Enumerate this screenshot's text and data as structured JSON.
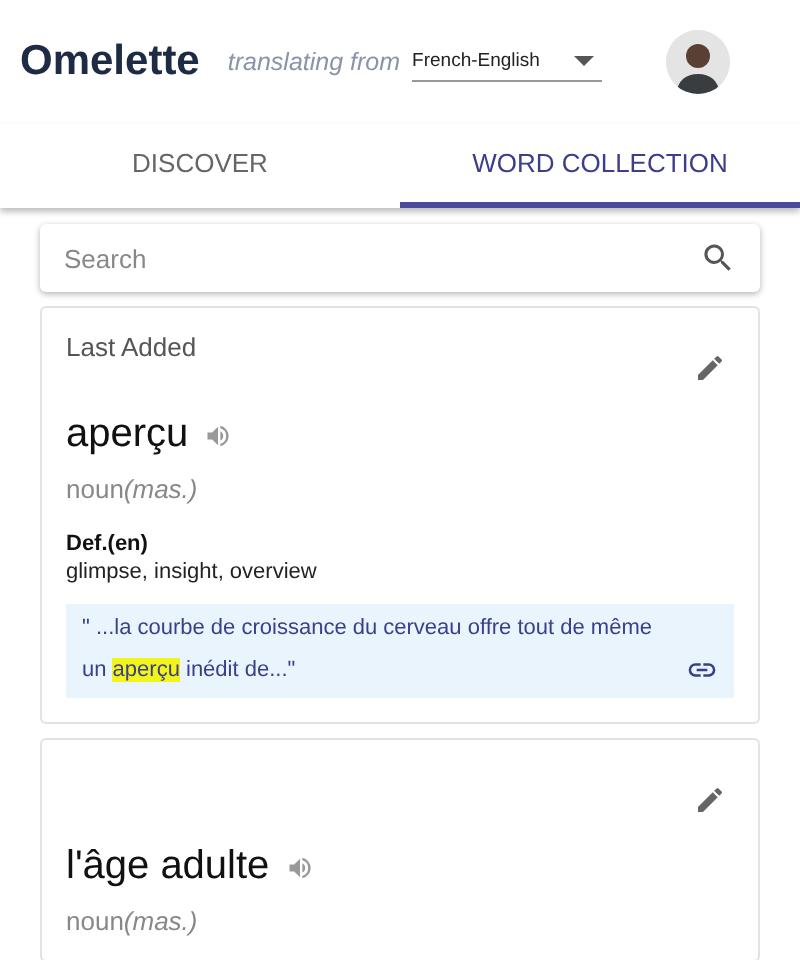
{
  "header": {
    "logo": "Omelette",
    "translating_label": "translating from",
    "language": "French-English"
  },
  "tabs": [
    {
      "label": "DISCOVER",
      "selected": false
    },
    {
      "label": "WORD COLLECTION",
      "selected": true
    }
  ],
  "search": {
    "placeholder": "Search"
  },
  "words": [
    {
      "section": "Last Added",
      "word": "aperçu",
      "part_of_speech": "noun",
      "gender": "(mas.)",
      "definition_label": "Def.(en)",
      "definition": "glimpse, insight, overview",
      "example": [
        {
          "text": "\" ...la courbe de croissance du cerveau offre tout de même un ",
          "highlight": false
        },
        {
          "text": "aperçu",
          "highlight": true
        },
        {
          "text": " inédit de...\"",
          "highlight": false
        }
      ]
    },
    {
      "word": "l'âge adulte",
      "part_of_speech": "noun",
      "gender": "(mas.)"
    }
  ]
}
